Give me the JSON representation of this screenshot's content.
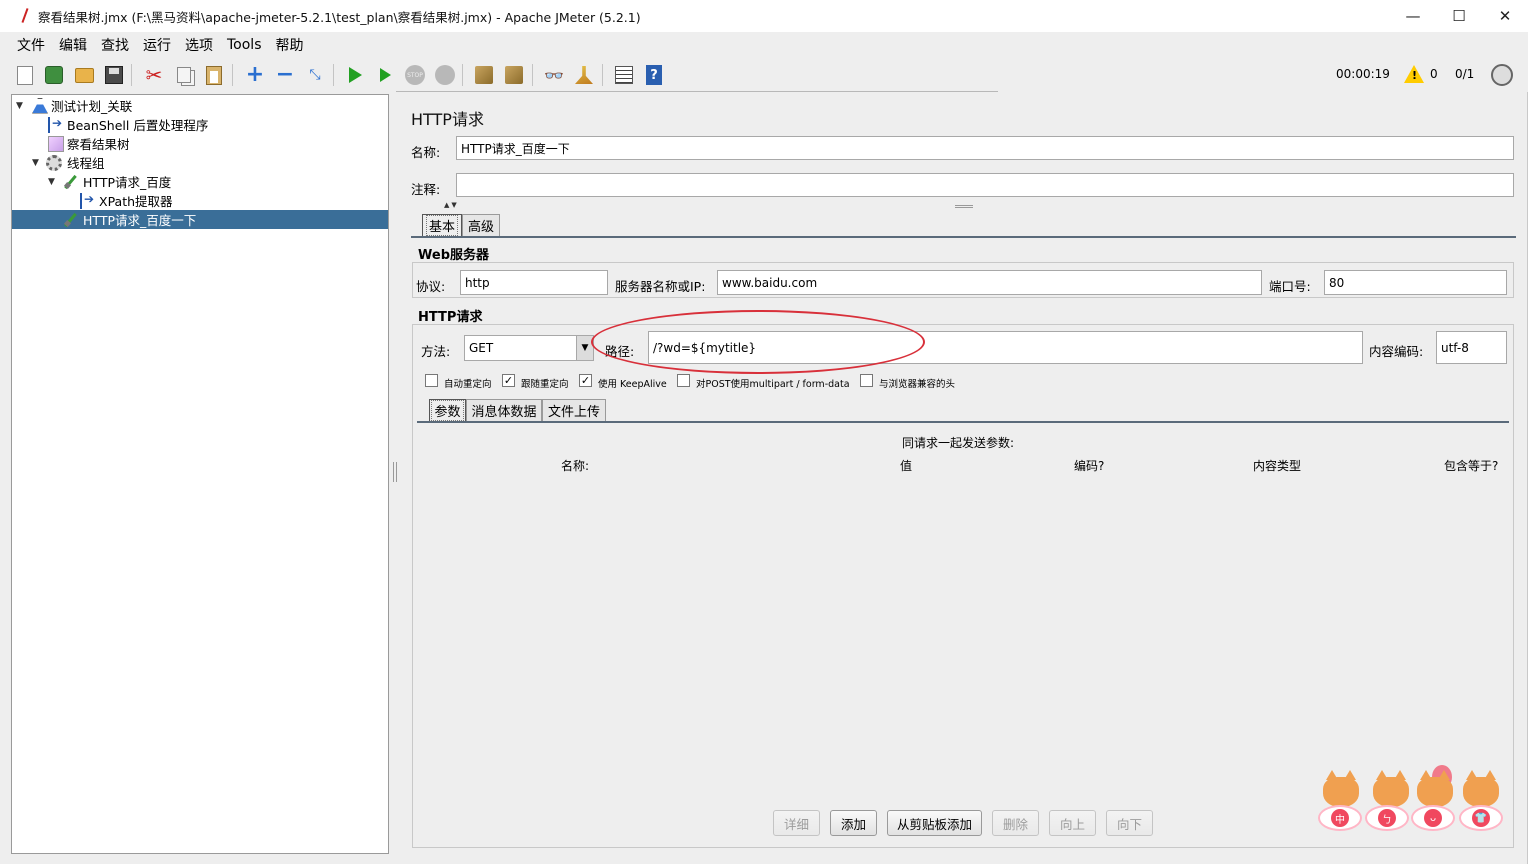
{
  "window": {
    "title": "察看结果树.jmx (F:\\黑马资料\\apache-jmeter-5.2.1\\test_plan\\察看结果树.jmx) - Apache JMeter (5.2.1)",
    "controls": {
      "minimize": "—",
      "maximize": "☐",
      "close": "✕"
    }
  },
  "menu": [
    "文件",
    "编辑",
    "查找",
    "运行",
    "选项",
    "Tools",
    "帮助"
  ],
  "toolbar": {
    "icons": [
      "new-icon",
      "templates-icon",
      "open-icon",
      "save-icon",
      "cut-icon",
      "copy-icon",
      "paste-icon",
      "expand-icon",
      "collapse-icon",
      "toggle-icon",
      "start-icon",
      "start-no-pauses-icon",
      "stop-icon",
      "shutdown-icon",
      "clear-icon",
      "clear-all-icon",
      "search-icon",
      "reset-search-icon",
      "function-helper-icon",
      "help-icon"
    ],
    "timer": "00:00:19",
    "warning_count": "0",
    "threads": "0/1"
  },
  "tree": [
    {
      "label": "测试计划_关联",
      "level": 0,
      "expanded": true,
      "icon": "test-plan-icon"
    },
    {
      "label": "BeanShell 后置处理程序",
      "level": 1,
      "icon": "post-processor-icon"
    },
    {
      "label": "察看结果树",
      "level": 1,
      "icon": "listener-icon"
    },
    {
      "label": "线程组",
      "level": 1,
      "expanded": true,
      "icon": "thread-group-icon"
    },
    {
      "label": "HTTP请求_百度",
      "level": 2,
      "expanded": true,
      "icon": "sampler-icon"
    },
    {
      "label": "XPath提取器",
      "level": 3,
      "icon": "post-processor-icon"
    },
    {
      "label": "HTTP请求_百度一下",
      "level": 2,
      "selected": true,
      "icon": "sampler-icon"
    }
  ],
  "sampler": {
    "title": "HTTP请求",
    "name_label": "名称:",
    "name_value": "HTTP请求_百度一下",
    "comment_label": "注释:",
    "comment_value": "",
    "tabs": [
      "基本",
      "高级"
    ],
    "web_server": {
      "title": "Web服务器",
      "protocol_label": "协议:",
      "protocol_value": "http",
      "server_label": "服务器名称或IP:",
      "server_value": "www.baidu.com",
      "port_label": "端口号:",
      "port_value": "80"
    },
    "http_request": {
      "title": "HTTP请求",
      "method_label": "方法:",
      "method_value": "GET",
      "path_label": "路径:",
      "path_value": "/?wd=${mytitle}",
      "encoding_label": "内容编码:",
      "encoding_value": "utf-8"
    },
    "checkboxes": [
      {
        "label": "自动重定向",
        "checked": false
      },
      {
        "label": "跟随重定向",
        "checked": true
      },
      {
        "label": "使用 KeepAlive",
        "checked": true
      },
      {
        "label": "对POST使用multipart / form-data",
        "checked": false
      },
      {
        "label": "与浏览器兼容的头",
        "checked": false
      }
    ],
    "sub_tabs": [
      "参数",
      "消息体数据",
      "文件上传"
    ],
    "params": {
      "caption": "同请求一起发送参数:",
      "columns": [
        "名称:",
        "值",
        "编码?",
        "内容类型",
        "包含等于?"
      ]
    },
    "buttons": [
      {
        "label": "详细",
        "enabled": false
      },
      {
        "label": "添加",
        "enabled": true
      },
      {
        "label": "从剪贴板添加",
        "enabled": true
      },
      {
        "label": "删除",
        "enabled": false
      },
      {
        "label": "向上",
        "enabled": false
      },
      {
        "label": "向下",
        "enabled": false
      }
    ]
  },
  "mascot_labels": [
    "中",
    "ㄅ",
    "ᴗ",
    "👕"
  ]
}
